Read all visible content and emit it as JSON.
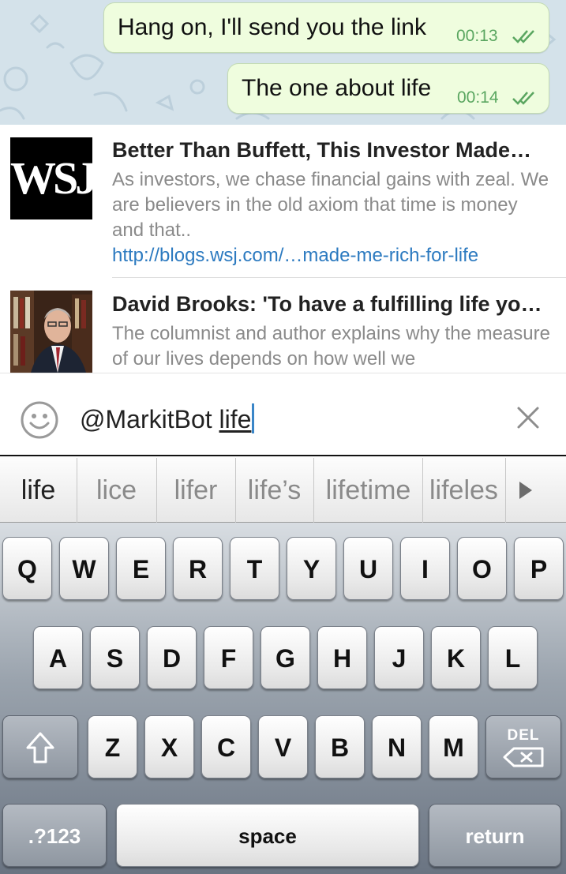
{
  "chat": {
    "messages": [
      {
        "text": "Hang on, I'll send you the link",
        "time": "00:13",
        "status": "read"
      },
      {
        "text": "The one about life",
        "time": "00:14",
        "status": "read"
      }
    ]
  },
  "results": [
    {
      "thumb": "WSJ",
      "title": "Better Than Buffett, This Investor Made…",
      "description": "As investors, we chase financial gains with zeal. We are believers in the old axiom that time is money and that..",
      "link": "http://blogs.wsj.com/…made-me-rich-for-life"
    },
    {
      "thumb": "portrait",
      "title": "David Brooks: 'To have a fulfilling life yo…",
      "description": "The columnist and author explains why the measure of our lives depends on how well we"
    }
  ],
  "input": {
    "mention": "@MarkitBot",
    "word": "life"
  },
  "suggestions": [
    "life",
    "lice",
    "lifer",
    "life’s",
    "lifetime",
    "lifeles"
  ],
  "keyboard": {
    "row1": [
      "Q",
      "W",
      "E",
      "R",
      "T",
      "Y",
      "U",
      "I",
      "O",
      "P"
    ],
    "row2": [
      "A",
      "S",
      "D",
      "F",
      "G",
      "H",
      "J",
      "K",
      "L"
    ],
    "row3": [
      "Z",
      "X",
      "C",
      "V",
      "B",
      "N",
      "M"
    ],
    "del_label": "DEL",
    "numbers_label": ".?123",
    "space_label": "space",
    "return_label": "return"
  },
  "colors": {
    "chat_bg": "#d4e2ea",
    "bubble_bg": "#effdde",
    "time_green": "#5aa660",
    "link_blue": "#2c7ac0",
    "caret_blue": "#3a86c8"
  },
  "icons": [
    "emoji-icon",
    "clear-icon",
    "more-suggestions-arrow-icon",
    "shift-icon",
    "backspace-icon",
    "double-check-icon"
  ]
}
